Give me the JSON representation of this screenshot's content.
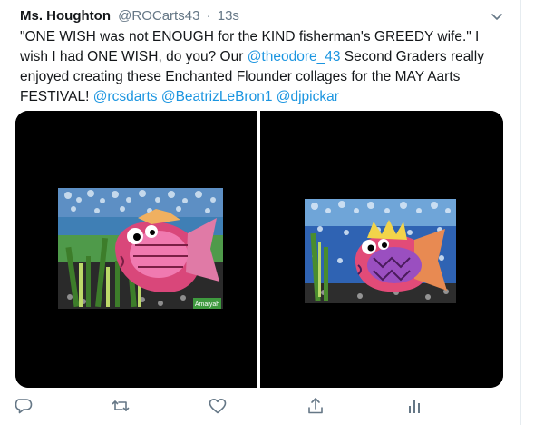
{
  "tweet": {
    "author_name": "Ms. Houghton",
    "author_handle": "@ROCarts43",
    "separator": "·",
    "time": "13s",
    "text_parts": [
      {
        "type": "text",
        "value": "\"ONE WISH was not ENOUGH for the KIND fisherman's GREEDY wife.\" I wish I had ONE WISH, do you? Our "
      },
      {
        "type": "mention",
        "value": "@theodore_43"
      },
      {
        "type": "text",
        "value": " Second Graders really enjoyed creating these Enchanted Flounder collages for the MAY Aarts FESTIVAL! "
      },
      {
        "type": "mention",
        "value": "@rcsdarts"
      },
      {
        "type": "text",
        "value": " "
      },
      {
        "type": "mention",
        "value": "@BeatrizLeBron1"
      },
      {
        "type": "text",
        "value": "  "
      },
      {
        "type": "mention",
        "value": "@djpickar"
      }
    ]
  },
  "media": {
    "left_artwork": {
      "signature": "Amaiyah"
    }
  },
  "actions": {
    "icons": [
      "reply-icon",
      "retweet-icon",
      "like-icon",
      "share-icon",
      "analytics-icon"
    ]
  },
  "colors": {
    "mention": "#1b95e0",
    "secondary": "#657786",
    "media_background": "#000000"
  }
}
